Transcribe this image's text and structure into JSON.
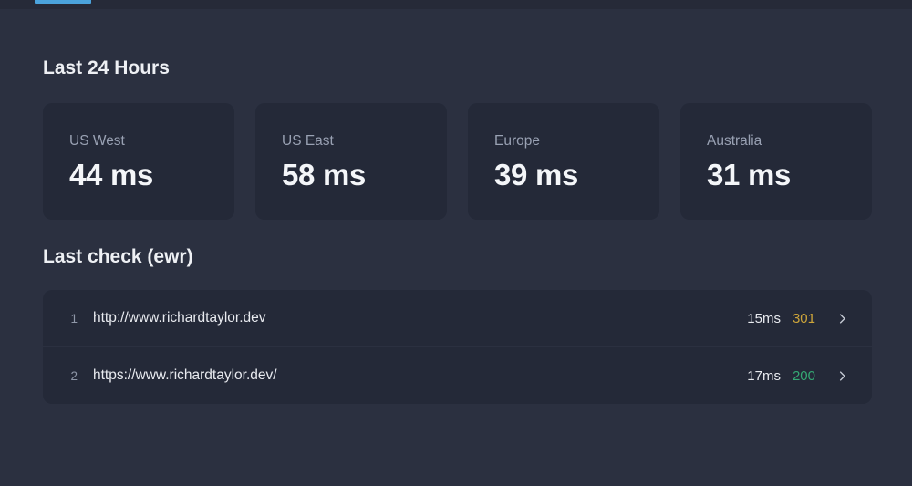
{
  "header": {
    "active_tab_indicator_color": "#4BA3DC"
  },
  "latency": {
    "heading": "Last 24 Hours",
    "cards": [
      {
        "region": "US West",
        "display": "44 ms",
        "latency_ms": 44
      },
      {
        "region": "US East",
        "display": "58 ms",
        "latency_ms": 58
      },
      {
        "region": "Europe",
        "display": "39 ms",
        "latency_ms": 39
      },
      {
        "region": "Australia",
        "display": "31 ms",
        "latency_ms": 31
      }
    ]
  },
  "last_check": {
    "heading": "Last check (ewr)",
    "rows": [
      {
        "index": "1",
        "url": "http://www.richardtaylor.dev",
        "response_time": "15ms",
        "status_code": "301",
        "status_color": "#CDA53A"
      },
      {
        "index": "2",
        "url": "https://www.richardtaylor.dev/",
        "response_time": "17ms",
        "status_code": "200",
        "status_color": "#34A873"
      }
    ]
  },
  "colors": {
    "page_background": "#2B3040",
    "top_strip_background": "#262A38",
    "card_background": "#242938",
    "heading_text": "#EEF0F4",
    "label_text": "#99A1B3",
    "value_text": "#F4F6F9",
    "status_redirect": "#CDA53A",
    "status_ok": "#34A873",
    "accent_blue": "#4BA3DC"
  }
}
